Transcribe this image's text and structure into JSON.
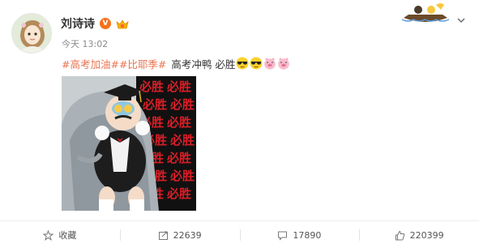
{
  "user": {
    "name": "刘诗诗",
    "vip_badge": "V",
    "timestamp": "今天 13:02"
  },
  "post": {
    "topic_1": "#高考加油#",
    "topic_2": "#比耶季#",
    "text": "高考冲鸭 必胜",
    "emojis": [
      "sunglasses-emoji",
      "sunglasses-emoji",
      "pig-emoji",
      "pig-emoji"
    ]
  },
  "photo": {
    "sign_text": "必胜"
  },
  "actions": {
    "favorite_label": "收藏",
    "repost_count": "22639",
    "comment_count": "17890",
    "like_count": "220399"
  },
  "colors": {
    "topic": "#eb7350",
    "badge": "#f3721b",
    "action_text": "#555555"
  }
}
